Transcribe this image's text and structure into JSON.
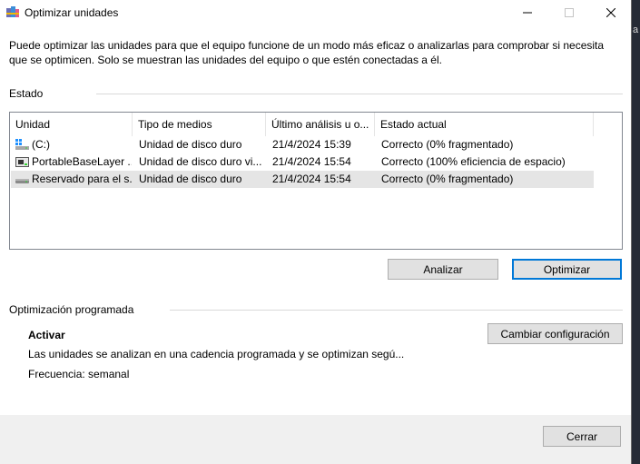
{
  "window": {
    "title": "Optimizar unidades"
  },
  "description": "Puede optimizar las unidades para que el equipo funcione de un modo más eficaz o analizarlas para comprobar si necesita que se optimicen. Solo se muestran las unidades del equipo o que estén conectadas a él.",
  "status": {
    "label": "Estado",
    "columns": [
      "Unidad",
      "Tipo de medios",
      "Último análisis u o...",
      "Estado actual"
    ],
    "drives": [
      {
        "icon": "windows-drive-icon",
        "unit": "(C:)",
        "media_type": "Unidad de disco duro",
        "last_run": "21/4/2024 15:39",
        "current_status": "Correcto (0% fragmentado)",
        "selected": false
      },
      {
        "icon": "virtual-drive-icon",
        "unit": "PortableBaseLayer ...",
        "media_type": "Unidad de disco duro vi...",
        "last_run": "21/4/2024 15:54",
        "current_status": "Correcto (100% eficiencia de espacio)",
        "selected": false
      },
      {
        "icon": "hard-drive-icon",
        "unit": "Reservado para el s...",
        "media_type": "Unidad de disco duro",
        "last_run": "21/4/2024 15:54",
        "current_status": "Correcto (0% fragmentado)",
        "selected": true
      }
    ]
  },
  "actions": {
    "analyze": "Analizar",
    "optimize": "Optimizar"
  },
  "scheduled": {
    "label": "Optimización programada",
    "state": "Activar",
    "description": "Las unidades se analizan en una cadencia programada y se optimizan segú...",
    "frequency": "Frecuencia: semanal",
    "change_settings": "Cambiar configuración"
  },
  "footer": {
    "close": "Cerrar"
  },
  "desktop": {
    "edge_glyph": "a"
  }
}
